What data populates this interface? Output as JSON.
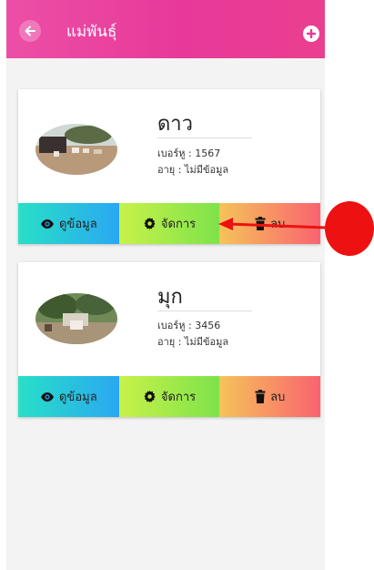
{
  "appbar": {
    "title": "แม่พันธุ์",
    "back_icon": "arrow-left-icon",
    "add_icon": "plus-circle-icon"
  },
  "cards": [
    {
      "name": "ดาว",
      "number_label": "เบอร์หู : 1567",
      "age_label": "อายุ : ไม่มีข้อมูล",
      "view_label": "ดูข้อมูล",
      "manage_label": "จัดการ",
      "delete_label": "ลบ"
    },
    {
      "name": "มุก",
      "number_label": "เบอร์หู : 3456",
      "age_label": "อายุ : ไม่มีข้อมูล",
      "view_label": "ดูข้อมูล",
      "manage_label": "จัดการ",
      "delete_label": "ลบ"
    }
  ],
  "icons": {
    "view": "eye-icon",
    "manage": "gear-icon",
    "delete": "trash-icon"
  },
  "colors": {
    "appbar": "#e8399a",
    "annotation": "#ee1111"
  }
}
